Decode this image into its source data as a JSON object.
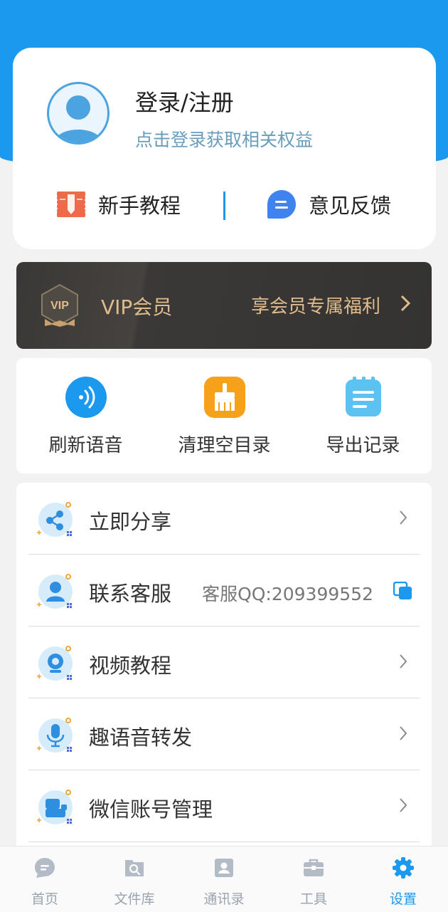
{
  "profile": {
    "login_title": "登录/注册",
    "login_subtitle": "点击登录获取相关权益",
    "tutorial_label": "新手教程",
    "feedback_label": "意见反馈"
  },
  "vip": {
    "title": "VIP会员",
    "badge_text": "VIP",
    "promo": "享会员专属福利"
  },
  "actions": [
    {
      "label": "刷新语音",
      "icon": "voice-refresh-icon"
    },
    {
      "label": "清理空目录",
      "icon": "broom-icon"
    },
    {
      "label": "导出记录",
      "icon": "notepad-icon"
    }
  ],
  "menu": [
    {
      "label": "立即分享",
      "icon": "share-icon"
    },
    {
      "label": "联系客服",
      "icon": "customer-service-icon",
      "value": "客服QQ:209399552"
    },
    {
      "label": "视频教程",
      "icon": "video-camera-icon"
    },
    {
      "label": "趣语音转发",
      "icon": "microphone-icon"
    },
    {
      "label": "微信账号管理",
      "icon": "account-icon"
    }
  ],
  "tabbar": [
    {
      "label": "首页",
      "icon": "chat-bubble-icon"
    },
    {
      "label": "文件库",
      "icon": "file-search-icon"
    },
    {
      "label": "通讯录",
      "icon": "contacts-icon"
    },
    {
      "label": "工具",
      "icon": "toolbox-icon"
    },
    {
      "label": "设置",
      "icon": "gear-icon",
      "active": true
    }
  ],
  "colors": {
    "primary": "#1a99ef",
    "vip_gold": "#e0bb8b",
    "vip_bg": "#3a3836",
    "tab_inactive": "#9aa4b0"
  }
}
